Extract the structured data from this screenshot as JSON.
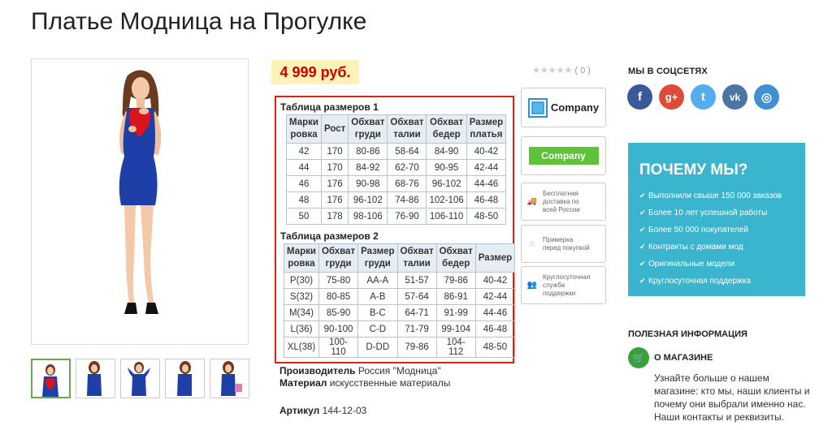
{
  "product": {
    "title": "Платье Модница на Прогулке",
    "price": "4 999 руб."
  },
  "size_tables": {
    "table1": {
      "title": "Таблица размеров 1",
      "headers": [
        [
          "Марки",
          "ровка"
        ],
        [
          "Рост",
          ""
        ],
        [
          "Обхват",
          "груди"
        ],
        [
          "Обхват",
          "талии"
        ],
        [
          "Обхват",
          "бедер"
        ],
        [
          "Размер",
          "платья"
        ]
      ],
      "rows": [
        [
          "42",
          "170",
          "80-86",
          "58-64",
          "84-90",
          "40-42"
        ],
        [
          "44",
          "170",
          "84-92",
          "62-70",
          "90-95",
          "42-44"
        ],
        [
          "46",
          "176",
          "90-98",
          "68-76",
          "96-102",
          "44-46"
        ],
        [
          "48",
          "176",
          "96-102",
          "74-86",
          "102-106",
          "46-48"
        ],
        [
          "50",
          "178",
          "98-106",
          "76-90",
          "106-110",
          "48-50"
        ]
      ]
    },
    "table2": {
      "title": "Таблица размеров 2",
      "headers": [
        [
          "Марки",
          "ровка"
        ],
        [
          "Обхват",
          "груди"
        ],
        [
          "Размер",
          "груди"
        ],
        [
          "Обхват",
          "талии"
        ],
        [
          "Обхват",
          "бедер"
        ],
        [
          "Размер",
          ""
        ]
      ],
      "rows": [
        [
          "P(30)",
          "75-80",
          "AA-A",
          "51-57",
          "79-86",
          "40-42"
        ],
        [
          "S(32)",
          "80-85",
          "A-B",
          "57-64",
          "86-91",
          "42-44"
        ],
        [
          "M(34)",
          "85-90",
          "B-C",
          "64-71",
          "91-99",
          "44-46"
        ],
        [
          "L(36)",
          "90-100",
          "C-D",
          "71-79",
          "99-104",
          "46-48"
        ],
        [
          "XL(38)",
          "100-110",
          "D-DD",
          "79-86",
          "104-112",
          "48-50"
        ]
      ]
    }
  },
  "properties": {
    "manufacturer_label": "Производитель",
    "manufacturer_value": "Россия \"Модница\"",
    "material_label": "Материал",
    "material_value": "искусственные материалы",
    "article_label": "Артикул",
    "article_value": "144-12-03"
  },
  "rating": {
    "stars": "★★★★★",
    "count": "( 0 )"
  },
  "badges": {
    "company1": "Company",
    "company2": "Company",
    "delivery": [
      "Бесплатная",
      "доставка по",
      "всей России"
    ],
    "fitting": [
      "Примерка",
      "перед покупкой"
    ],
    "support": [
      "Круглосуточная",
      "служба",
      "поддержки"
    ]
  },
  "social": {
    "title": "МЫ В СОЦСЕТЯХ",
    "icons": [
      {
        "name": "facebook",
        "glyph": "f",
        "color": "#3b5998"
      },
      {
        "name": "google-plus",
        "glyph": "g+",
        "color": "#dd4b39"
      },
      {
        "name": "twitter",
        "glyph": "t",
        "color": "#55acee"
      },
      {
        "name": "vk",
        "glyph": "vk",
        "color": "#4c75a3"
      },
      {
        "name": "instagram",
        "glyph": "◎",
        "color": "#3f8fd2"
      }
    ]
  },
  "why": {
    "title": "ПОЧЕМУ МЫ?",
    "items": [
      "Выполнили свыше 150 000 заказов",
      "Более 10 лет успешной работы",
      "Более 50 000 покупателей",
      "Контракты с домами мод",
      "Оригинальные модели",
      "Круглосуточная поддержка"
    ]
  },
  "useful": {
    "title": "ПОЛЕЗНАЯ ИНФОРМАЦИЯ",
    "about_title": "О МАГАЗИНЕ",
    "about_text": "Узнайте больше о нашем магазине: кто мы, наши клиенты и почему они выбрали именно нас. Наши контакты и реквизиты."
  },
  "colors": {
    "price_bg": "#fdf3b8",
    "price_text": "#cc0000",
    "highlight_border": "#dd2211",
    "why_bg": "#3ab5cd",
    "green": "#5ec33a"
  }
}
